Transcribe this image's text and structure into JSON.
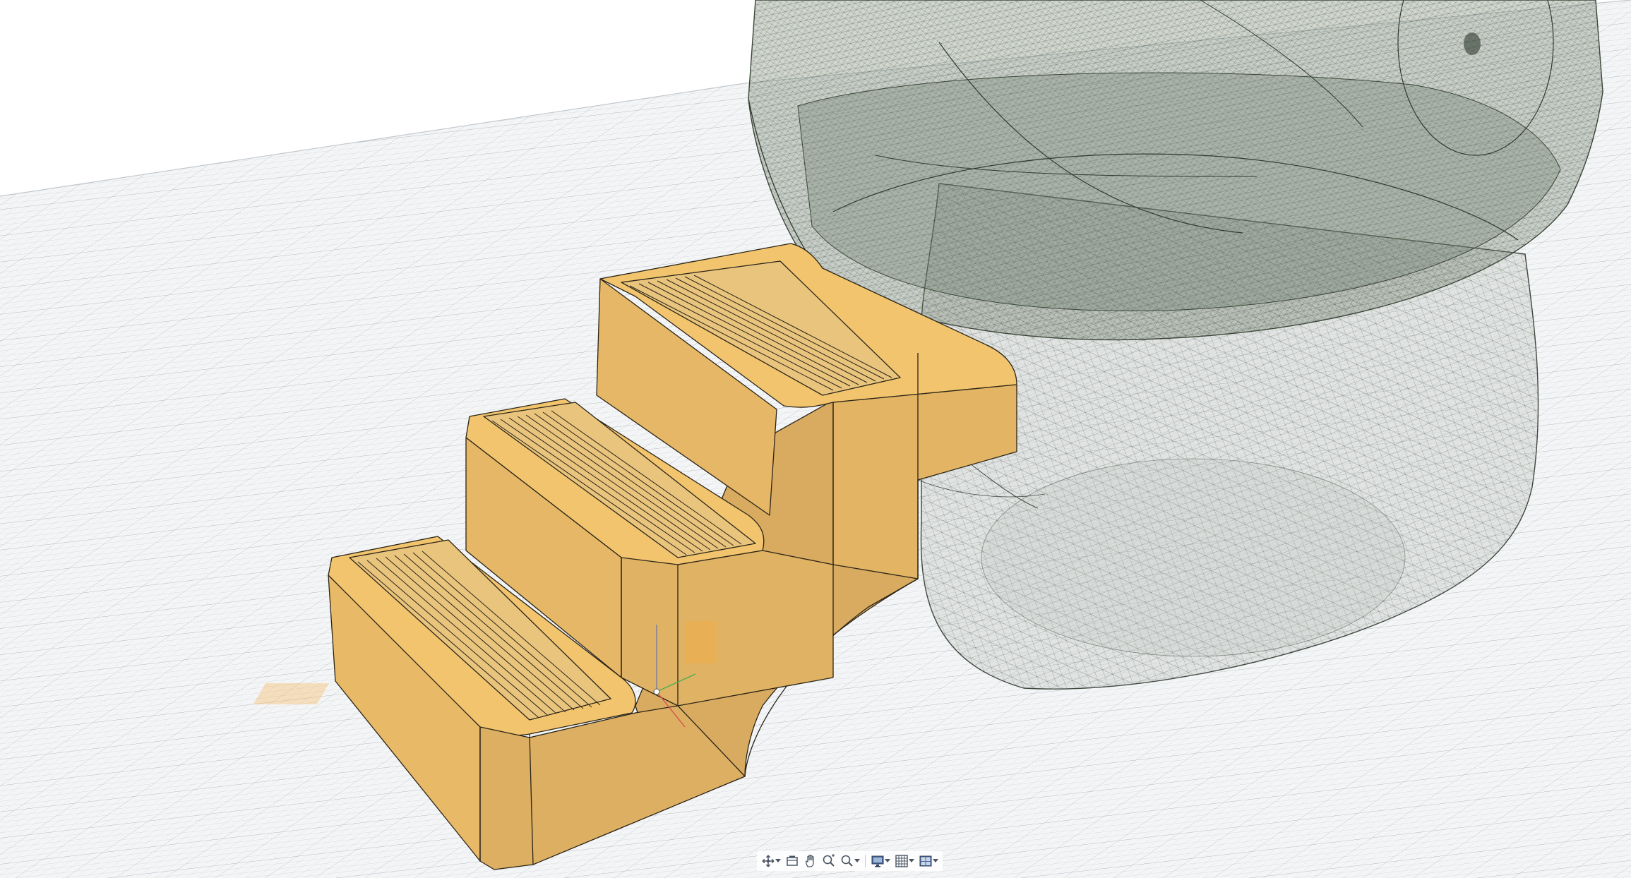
{
  "viewport": {
    "background": "#ffffff",
    "grid_color": "#c9cdd2",
    "grid_major_color": "#aab0b6"
  },
  "model": {
    "stairs": {
      "fill_top": "#f2c46e",
      "fill_front": "#e9b967",
      "fill_side": "#ddb066",
      "edge_color": "#2a2418",
      "step_count": 3,
      "tread_grooves_per_step": 12
    },
    "tub": {
      "fill": "#9aa89a",
      "mesh_color": "#4d5a4d",
      "opacity": 0.28
    }
  },
  "nav_bar": {
    "tools": [
      {
        "name": "orbit-icon",
        "has_menu": true
      },
      {
        "name": "look-at-icon",
        "has_menu": false
      },
      {
        "name": "pan-icon",
        "has_menu": false
      },
      {
        "name": "zoom-icon",
        "has_menu": false
      },
      {
        "name": "fit-icon",
        "has_menu": true
      },
      {
        "name": "display-settings-icon",
        "has_menu": true
      },
      {
        "name": "grid-settings-icon",
        "has_menu": true
      },
      {
        "name": "viewports-icon",
        "has_menu": true
      }
    ]
  }
}
